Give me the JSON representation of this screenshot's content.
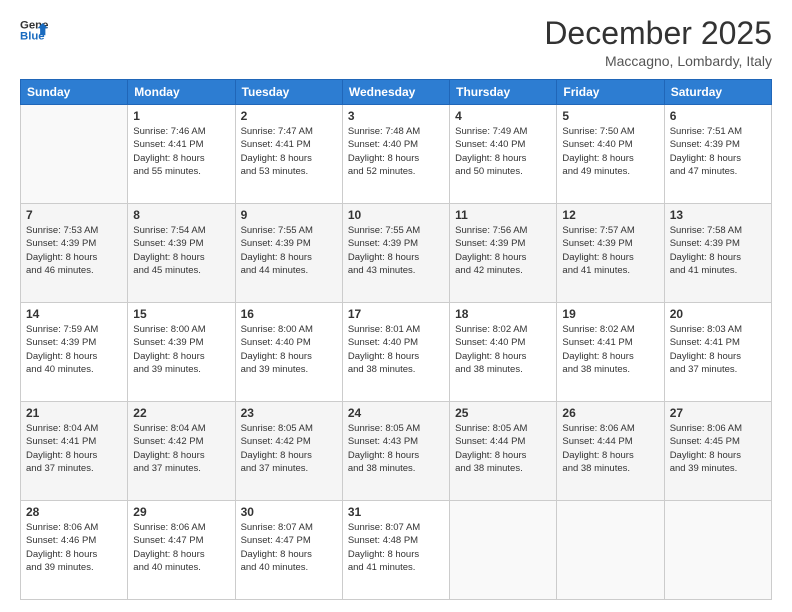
{
  "header": {
    "logo_line1": "General",
    "logo_line2": "Blue",
    "month": "December 2025",
    "location": "Maccagno, Lombardy, Italy"
  },
  "days_of_week": [
    "Sunday",
    "Monday",
    "Tuesday",
    "Wednesday",
    "Thursday",
    "Friday",
    "Saturday"
  ],
  "weeks": [
    [
      {
        "day": "",
        "info": ""
      },
      {
        "day": "1",
        "info": "Sunrise: 7:46 AM\nSunset: 4:41 PM\nDaylight: 8 hours\nand 55 minutes."
      },
      {
        "day": "2",
        "info": "Sunrise: 7:47 AM\nSunset: 4:41 PM\nDaylight: 8 hours\nand 53 minutes."
      },
      {
        "day": "3",
        "info": "Sunrise: 7:48 AM\nSunset: 4:40 PM\nDaylight: 8 hours\nand 52 minutes."
      },
      {
        "day": "4",
        "info": "Sunrise: 7:49 AM\nSunset: 4:40 PM\nDaylight: 8 hours\nand 50 minutes."
      },
      {
        "day": "5",
        "info": "Sunrise: 7:50 AM\nSunset: 4:40 PM\nDaylight: 8 hours\nand 49 minutes."
      },
      {
        "day": "6",
        "info": "Sunrise: 7:51 AM\nSunset: 4:39 PM\nDaylight: 8 hours\nand 47 minutes."
      }
    ],
    [
      {
        "day": "7",
        "info": "Sunrise: 7:53 AM\nSunset: 4:39 PM\nDaylight: 8 hours\nand 46 minutes."
      },
      {
        "day": "8",
        "info": "Sunrise: 7:54 AM\nSunset: 4:39 PM\nDaylight: 8 hours\nand 45 minutes."
      },
      {
        "day": "9",
        "info": "Sunrise: 7:55 AM\nSunset: 4:39 PM\nDaylight: 8 hours\nand 44 minutes."
      },
      {
        "day": "10",
        "info": "Sunrise: 7:55 AM\nSunset: 4:39 PM\nDaylight: 8 hours\nand 43 minutes."
      },
      {
        "day": "11",
        "info": "Sunrise: 7:56 AM\nSunset: 4:39 PM\nDaylight: 8 hours\nand 42 minutes."
      },
      {
        "day": "12",
        "info": "Sunrise: 7:57 AM\nSunset: 4:39 PM\nDaylight: 8 hours\nand 41 minutes."
      },
      {
        "day": "13",
        "info": "Sunrise: 7:58 AM\nSunset: 4:39 PM\nDaylight: 8 hours\nand 41 minutes."
      }
    ],
    [
      {
        "day": "14",
        "info": "Sunrise: 7:59 AM\nSunset: 4:39 PM\nDaylight: 8 hours\nand 40 minutes."
      },
      {
        "day": "15",
        "info": "Sunrise: 8:00 AM\nSunset: 4:39 PM\nDaylight: 8 hours\nand 39 minutes."
      },
      {
        "day": "16",
        "info": "Sunrise: 8:00 AM\nSunset: 4:40 PM\nDaylight: 8 hours\nand 39 minutes."
      },
      {
        "day": "17",
        "info": "Sunrise: 8:01 AM\nSunset: 4:40 PM\nDaylight: 8 hours\nand 38 minutes."
      },
      {
        "day": "18",
        "info": "Sunrise: 8:02 AM\nSunset: 4:40 PM\nDaylight: 8 hours\nand 38 minutes."
      },
      {
        "day": "19",
        "info": "Sunrise: 8:02 AM\nSunset: 4:41 PM\nDaylight: 8 hours\nand 38 minutes."
      },
      {
        "day": "20",
        "info": "Sunrise: 8:03 AM\nSunset: 4:41 PM\nDaylight: 8 hours\nand 37 minutes."
      }
    ],
    [
      {
        "day": "21",
        "info": "Sunrise: 8:04 AM\nSunset: 4:41 PM\nDaylight: 8 hours\nand 37 minutes."
      },
      {
        "day": "22",
        "info": "Sunrise: 8:04 AM\nSunset: 4:42 PM\nDaylight: 8 hours\nand 37 minutes."
      },
      {
        "day": "23",
        "info": "Sunrise: 8:05 AM\nSunset: 4:42 PM\nDaylight: 8 hours\nand 37 minutes."
      },
      {
        "day": "24",
        "info": "Sunrise: 8:05 AM\nSunset: 4:43 PM\nDaylight: 8 hours\nand 38 minutes."
      },
      {
        "day": "25",
        "info": "Sunrise: 8:05 AM\nSunset: 4:44 PM\nDaylight: 8 hours\nand 38 minutes."
      },
      {
        "day": "26",
        "info": "Sunrise: 8:06 AM\nSunset: 4:44 PM\nDaylight: 8 hours\nand 38 minutes."
      },
      {
        "day": "27",
        "info": "Sunrise: 8:06 AM\nSunset: 4:45 PM\nDaylight: 8 hours\nand 39 minutes."
      }
    ],
    [
      {
        "day": "28",
        "info": "Sunrise: 8:06 AM\nSunset: 4:46 PM\nDaylight: 8 hours\nand 39 minutes."
      },
      {
        "day": "29",
        "info": "Sunrise: 8:06 AM\nSunset: 4:47 PM\nDaylight: 8 hours\nand 40 minutes."
      },
      {
        "day": "30",
        "info": "Sunrise: 8:07 AM\nSunset: 4:47 PM\nDaylight: 8 hours\nand 40 minutes."
      },
      {
        "day": "31",
        "info": "Sunrise: 8:07 AM\nSunset: 4:48 PM\nDaylight: 8 hours\nand 41 minutes."
      },
      {
        "day": "",
        "info": ""
      },
      {
        "day": "",
        "info": ""
      },
      {
        "day": "",
        "info": ""
      }
    ]
  ]
}
